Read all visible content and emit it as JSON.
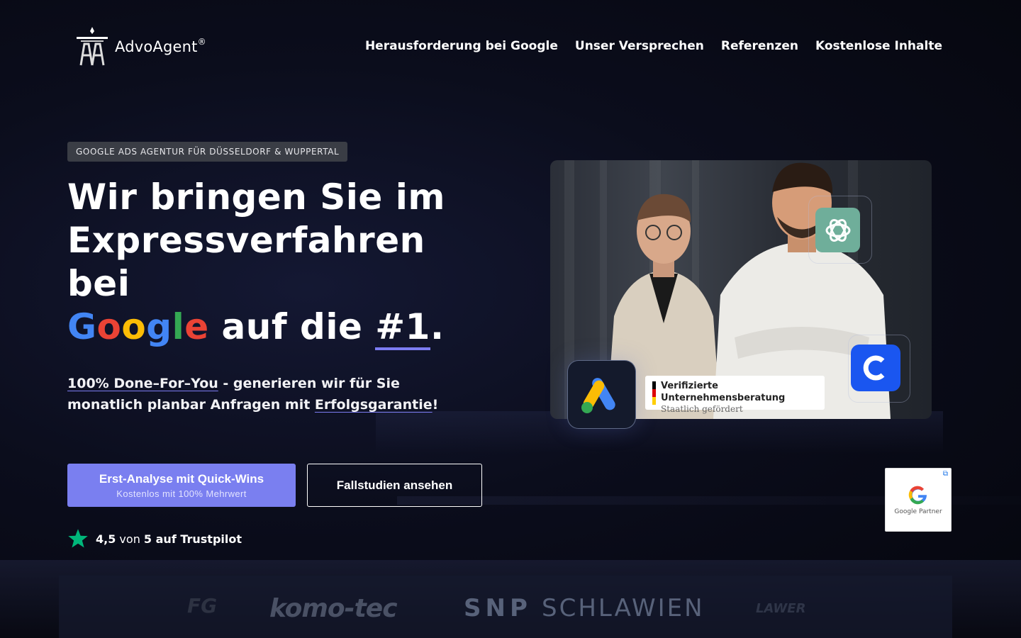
{
  "brand": {
    "name_bold": "Advo",
    "name_rest": "Agent",
    "reg": "®"
  },
  "nav": {
    "items": [
      {
        "label": "Herausforderung bei Google"
      },
      {
        "label": "Unser Versprechen"
      },
      {
        "label": "Referenzen"
      },
      {
        "label": "Kostenlose Inhalte"
      }
    ]
  },
  "hero": {
    "badge": "GOOGLE ADS AGENTUR FÜR DÜSSELDORF & WUPPERTAL",
    "headline": {
      "line1": "Wir bringen Sie im",
      "line2": "Expressverfahren",
      "line3": "bei",
      "google_letters": [
        "G",
        "o",
        "o",
        "g",
        "l",
        "e"
      ],
      "line4_rest": " auf die ",
      "rank": "#1",
      "period": "."
    },
    "sub": {
      "link1": "100% Done–For–You",
      "text1": " - generieren wir für Sie monatlich planbar Anfragen mit ",
      "link2": "Erfolgsgarantie",
      "end": "!"
    },
    "cta_primary": {
      "title": "Erst-Analyse mit Quick-Wins",
      "subtitle": "Kostenlos mit 100% Mehrwert"
    },
    "cta_secondary": {
      "label": "Fallstudien ansehen"
    },
    "rating": {
      "score": "4,5",
      "of": " von ",
      "max": "5 auf Trustpilot"
    }
  },
  "image_card": {
    "verified_title": "Verifizierte Unternehmensberatung",
    "verified_sub": "Staatlich gefördert",
    "partner_label": "Google Partner"
  },
  "clients": {
    "logos": [
      "FG",
      "komo-tec",
      "SNP",
      "SCHLAWIEN",
      "LAWER"
    ]
  },
  "colors": {
    "accent": "#7a7ff0",
    "google_blue": "#4285f4",
    "google_red": "#ea4335",
    "google_yellow": "#fbbc05",
    "google_green": "#34a853",
    "trustpilot": "#00b67a"
  }
}
